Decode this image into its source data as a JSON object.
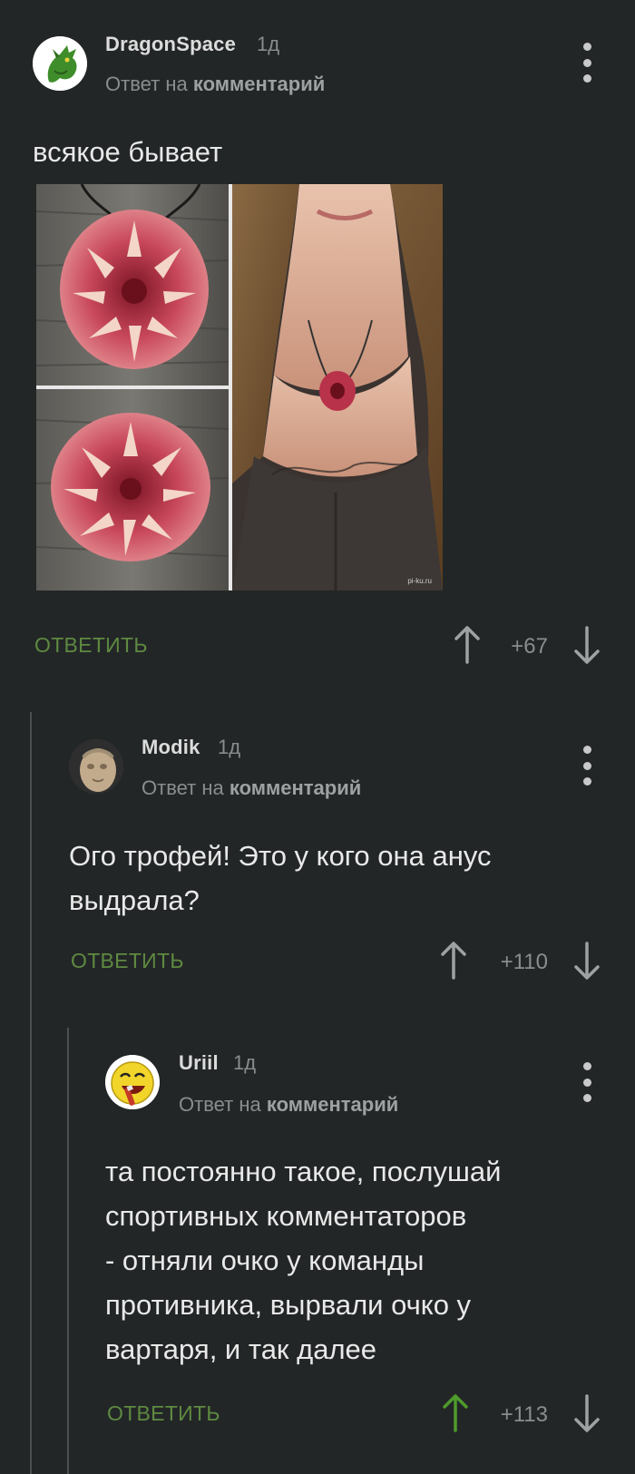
{
  "comments": [
    {
      "author": "DragonSpace",
      "time": "1д",
      "reply_prefix": "Ответ на",
      "reply_target": "комментарий",
      "text": "всякое бывает",
      "reply_label": "ОТВЕТИТЬ",
      "score": "+67",
      "voted_up": false,
      "has_image": true,
      "image_watermark": "pi-ku.ru"
    },
    {
      "author": "Modik",
      "time": "1д",
      "reply_prefix": "Ответ на",
      "reply_target": "комментарий",
      "text_lines": [
        "Ого трофей! Это у кого она анус",
        "выдрала?"
      ],
      "reply_label": "ОТВЕТИТЬ",
      "score": "+110",
      "voted_up": false
    },
    {
      "author": "Uriil",
      "time": "1д",
      "reply_prefix": "Ответ на",
      "reply_target": "комментарий",
      "text_lines": [
        "та постоянно такое, послушай",
        "спортивных комментаторов",
        "- отняли очко у команды",
        "противника, вырвали очко у",
        "вартаря, и так далее"
      ],
      "reply_label": "ОТВЕТИТЬ",
      "score": "+113",
      "voted_up": true
    }
  ],
  "colors": {
    "background": "#232627",
    "accent_green": "#5e8a41",
    "upvote_active": "#4f9a2c",
    "muted": "#8a8d8e"
  },
  "icons": {
    "upvote": "arrow-up-icon",
    "downvote": "arrow-down-icon",
    "menu": "more-vertical-icon"
  }
}
